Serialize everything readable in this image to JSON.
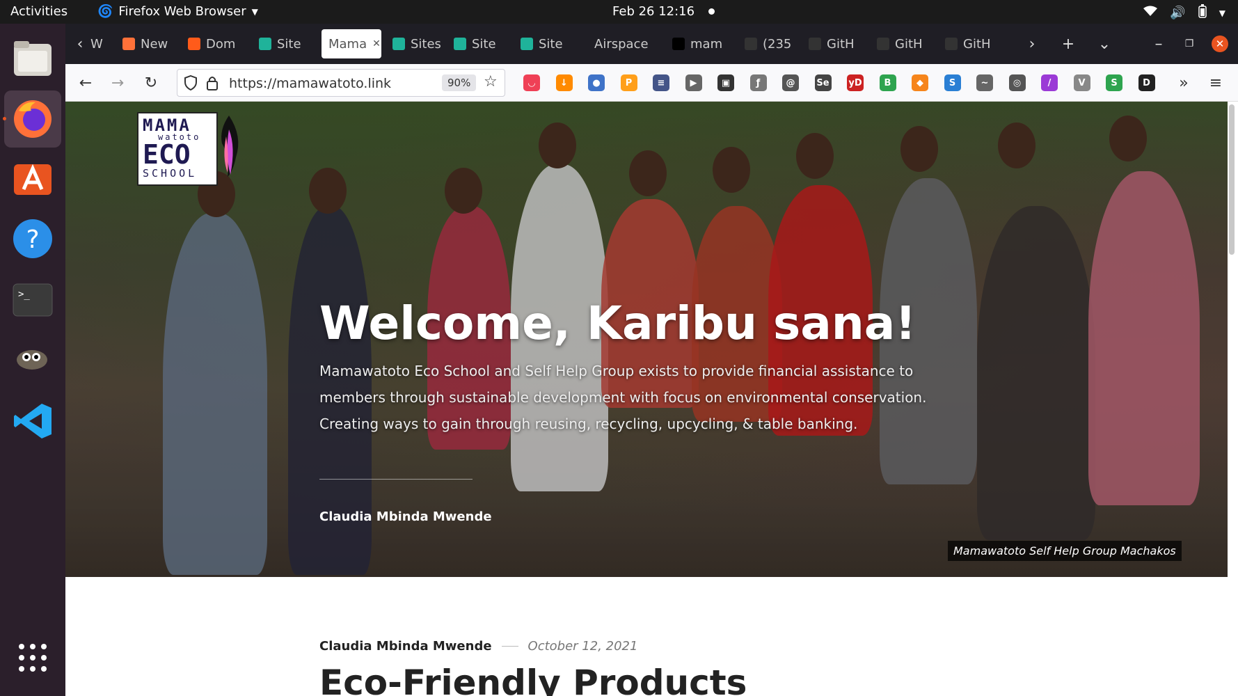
{
  "topbar": {
    "activities": "Activities",
    "app_name": "Firefox Web Browser",
    "clock": "Feb 26  12:16"
  },
  "dock": {
    "items": [
      "files-icon",
      "firefox-icon",
      "software-center-icon",
      "help-icon",
      "terminal-icon",
      "gimp-icon",
      "vscode-icon",
      "app-grid-icon"
    ]
  },
  "tabs": [
    {
      "label": "W",
      "color": "#555"
    },
    {
      "label": "New",
      "color": "#ff7139"
    },
    {
      "label": "Dom",
      "color": "#ff5b1a"
    },
    {
      "label": "Site",
      "color": "#1fb39a"
    },
    {
      "label": "Mama",
      "color": "#ffffff"
    },
    {
      "label": "Sites",
      "color": "#1fb39a"
    },
    {
      "label": "Site",
      "color": "#1fb39a"
    },
    {
      "label": "Site",
      "color": "#1fb39a"
    },
    {
      "label": "Airspace",
      "color": "#1f1e25"
    },
    {
      "label": "mam",
      "color": "#000000"
    },
    {
      "label": "(235",
      "color": "#333333"
    },
    {
      "label": "GitH",
      "color": "#333333"
    },
    {
      "label": "GitH",
      "color": "#333333"
    },
    {
      "label": "GitH",
      "color": "#333333"
    }
  ],
  "navbar": {
    "url": "https://mamawatoto.link",
    "zoom": "90%",
    "extensions": [
      {
        "name": "pocket-icon",
        "color": "#ef4056",
        "glyph": "◡"
      },
      {
        "name": "download-icon",
        "color": "#ff8a00",
        "glyph": "↓"
      },
      {
        "name": "globe-extension-icon",
        "color": "#3f73c8",
        "glyph": "●"
      },
      {
        "name": "orange-extension-icon",
        "color": "#ff9f1a",
        "glyph": "P"
      },
      {
        "name": "list-extension-icon",
        "color": "#445588",
        "glyph": "≡"
      },
      {
        "name": "play-extension-icon",
        "color": "#666666",
        "glyph": "▶"
      },
      {
        "name": "box-extension-icon",
        "color": "#333333",
        "glyph": "▣"
      },
      {
        "name": "feather-extension-icon",
        "color": "#777777",
        "glyph": "ƒ"
      },
      {
        "name": "swirl-extension-icon",
        "color": "#555555",
        "glyph": "@"
      },
      {
        "name": "selenium-extension-icon",
        "color": "#444444",
        "glyph": "Se"
      },
      {
        "name": "yd-extension-icon",
        "color": "#cc2222",
        "glyph": "yD"
      },
      {
        "name": "green-b-extension-icon",
        "color": "#2ea44f",
        "glyph": "B"
      },
      {
        "name": "metamask-icon",
        "color": "#f6851b",
        "glyph": "◆"
      },
      {
        "name": "s-extension-icon",
        "color": "#2a7fd4",
        "glyph": "S"
      },
      {
        "name": "squirrel-extension-icon",
        "color": "#666666",
        "glyph": "~"
      },
      {
        "name": "circle-extension-icon",
        "color": "#555555",
        "glyph": "◎"
      },
      {
        "name": "pen-extension-icon",
        "color": "#9b3ad6",
        "glyph": "/"
      },
      {
        "name": "v-extension-icon",
        "color": "#888888",
        "glyph": "V"
      },
      {
        "name": "shield-extension-icon",
        "color": "#2ea44f",
        "glyph": "S"
      },
      {
        "name": "d-extension-icon",
        "color": "#222222",
        "glyph": "D"
      }
    ]
  },
  "hero": {
    "logo": {
      "line1": "MAMA",
      "line2": "watoto",
      "line3": "ECO",
      "line4": "SCHOOL"
    },
    "heading": "Welcome, Karibu sana!",
    "intro": "Mamawatoto Eco School and Self Help Group exists to provide financial assistance to members through sustainable development with focus on environmental conservation. Creating ways to gain through reusing, recycling, upcycling, & table banking.",
    "author": "Claudia Mbinda Mwende",
    "caption": "Mamawatoto Self Help Group Machakos"
  },
  "post": {
    "author": "Claudia Mbinda Mwende",
    "date": "October 12, 2021",
    "title": "Eco-Friendly Products"
  }
}
